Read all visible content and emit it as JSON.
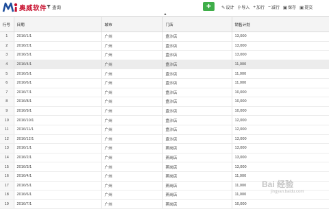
{
  "toolbar": {
    "brand": "奥威软件",
    "query_label": "查询",
    "actions": [
      {
        "icon": "pencil-icon",
        "label": "设计"
      },
      {
        "icon": "user-import-icon",
        "label": "导入"
      },
      {
        "icon": "plus-icon",
        "label": "加行"
      },
      {
        "icon": "minus-icon",
        "label": "减行"
      },
      {
        "icon": "save-icon",
        "label": "保存"
      },
      {
        "icon": "submit-icon",
        "label": "提交"
      }
    ],
    "add_label": "+"
  },
  "table": {
    "headers": [
      "行号",
      "日期",
      "城市",
      "门店",
      "销售计划"
    ],
    "rows": [
      [
        "1",
        "2016/1/1",
        "广州",
        "盘沙店",
        "13,000"
      ],
      [
        "2",
        "2016/2/1",
        "广州",
        "盘沙店",
        "13,000"
      ],
      [
        "3",
        "2016/3/1",
        "广州",
        "盘沙店",
        "13,000"
      ],
      [
        "4",
        "2016/4/1",
        "广州",
        "盘沙店",
        "11,000"
      ],
      [
        "5",
        "2016/5/1",
        "广州",
        "盘沙店",
        "11,000"
      ],
      [
        "6",
        "2016/6/1",
        "广州",
        "盘沙店",
        "11,000"
      ],
      [
        "7",
        "2016/7/1",
        "广州",
        "盘沙店",
        "10,000"
      ],
      [
        "8",
        "2016/8/1",
        "广州",
        "盘沙店",
        "10,000"
      ],
      [
        "9",
        "2016/9/1",
        "广州",
        "盘沙店",
        "10,000"
      ],
      [
        "10",
        "2016/10/1",
        "广州",
        "盘沙店",
        "12,000"
      ],
      [
        "11",
        "2016/11/1",
        "广州",
        "盘沙店",
        "12,000"
      ],
      [
        "12",
        "2016/12/1",
        "广州",
        "盘沙店",
        "13,000"
      ],
      [
        "13",
        "2016/1/1",
        "广州",
        "燕岗店",
        "13,000"
      ],
      [
        "14",
        "2016/2/1",
        "广州",
        "燕岗店",
        "13,000"
      ],
      [
        "15",
        "2016/3/1",
        "广州",
        "燕岗店",
        "13,000"
      ],
      [
        "16",
        "2016/4/1",
        "广州",
        "燕岗店",
        "11,000"
      ],
      [
        "17",
        "2016/5/1",
        "广州",
        "燕岗店",
        "11,000"
      ],
      [
        "18",
        "2016/6/1",
        "广州",
        "燕岗店",
        "11,000"
      ],
      [
        "19",
        "2016/7/1",
        "广州",
        "燕岗店",
        "10,000"
      ]
    ],
    "selected_row": 3
  },
  "watermark": {
    "main": "Bai 经验",
    "sub": "jingyan.baidu.com"
  },
  "colors": {
    "brand_red": "#c8102e",
    "brand_blue": "#1f4e9c",
    "add_button": "#3fae49"
  }
}
